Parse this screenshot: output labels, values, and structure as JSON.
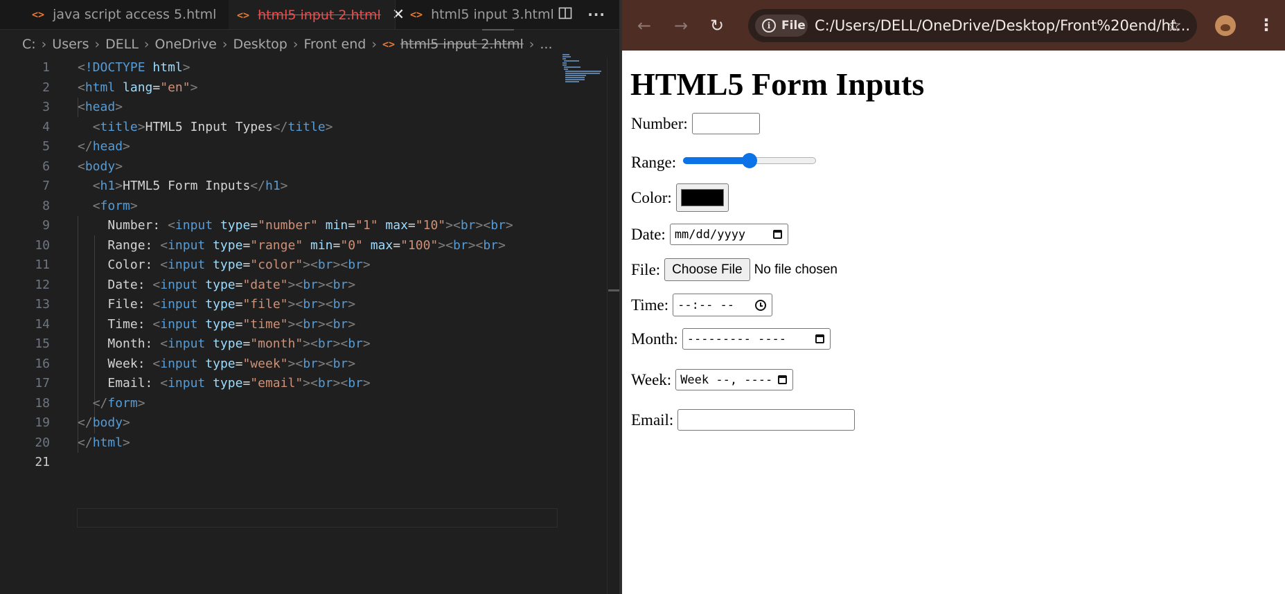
{
  "editor": {
    "tabs": [
      {
        "label": "java script access 5.html",
        "active": false
      },
      {
        "label": "html5 input 2.html",
        "active": true
      },
      {
        "label": "html5 input 3.html",
        "active": false
      }
    ],
    "actions": {
      "split_icon": "split-editor-icon",
      "more_icon": "more-actions-icon"
    },
    "breadcrumb": {
      "items": [
        "C:",
        "Users",
        "DELL",
        "OneDrive",
        "Desktop",
        "Front end"
      ],
      "file": "html5 input 2.html",
      "ellipsis": "..."
    },
    "line_numbers": [
      "1",
      "2",
      "3",
      "4",
      "5",
      "6",
      "7",
      "8",
      "9",
      "10",
      "11",
      "12",
      "13",
      "14",
      "15",
      "16",
      "17",
      "18",
      "19",
      "20",
      "21"
    ],
    "current_line": "21",
    "code": {
      "doctype_kw": "!DOCTYPE",
      "html": "html",
      "lang": "lang",
      "lang_val": "\"en\"",
      "head": "head",
      "title_tag": "title",
      "title_text": "HTML5 Input Types",
      "body": "body",
      "h1": "h1",
      "h1_text": "HTML5 Form Inputs",
      "form": "form",
      "input": "input",
      "br": "br",
      "type": "type",
      "min": "min",
      "max": "max",
      "labels": {
        "number": "Number: ",
        "range": "Range: ",
        "color": "Color: ",
        "date": "Date: ",
        "file": "File: ",
        "time": "Time: ",
        "month": "Month: ",
        "week": "Week: ",
        "email": "Email: "
      },
      "types": {
        "number": "\"number\"",
        "range": "\"range\"",
        "color": "\"color\"",
        "date": "\"date\"",
        "file": "\"file\"",
        "time": "\"time\"",
        "month": "\"month\"",
        "week": "\"week\"",
        "email": "\"email\""
      },
      "number_min": "\"1\"",
      "number_max": "\"10\"",
      "range_min": "\"0\"",
      "range_max": "\"100\""
    }
  },
  "browser": {
    "nav": {
      "back_icon": "back-arrow-icon",
      "forward_icon": "forward-arrow-icon",
      "reload_icon": "reload-icon"
    },
    "chip_label": "File",
    "url": "C:/Users/DELL/OneDrive/Desktop/Front%20end/ht...",
    "page": {
      "heading": "HTML5 Form Inputs",
      "number_label": "Number:",
      "range_label": "Range:",
      "range_value": 50,
      "color_label": "Color:",
      "color_value": "#000000",
      "date_label": "Date:",
      "date_placeholder": "mm/dd/yyyy",
      "file_label": "File:",
      "file_button": "Choose File",
      "file_status": "No file chosen",
      "time_label": "Time:",
      "time_placeholder": "--:-- --",
      "month_label": "Month:",
      "month_placeholder": "--------- ----",
      "week_label": "Week:",
      "week_placeholder": "Week --, ----",
      "email_label": "Email:"
    }
  },
  "colors": {
    "editor_bg": "#1f1f1f",
    "active_tab_text": "#f14c4c",
    "file_icon": "#e37933",
    "browser_toolbar": "#4e2e24",
    "range_accent": "#0b72e8"
  }
}
